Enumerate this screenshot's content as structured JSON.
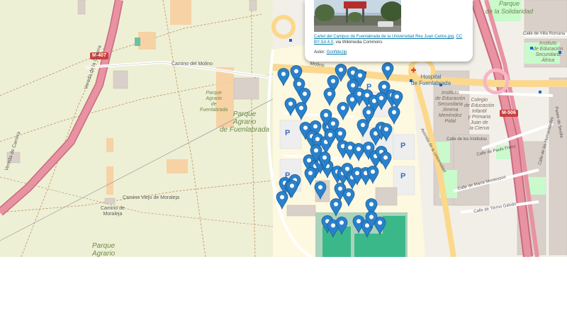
{
  "popup": {
    "caption_link": "Cartel del Campus de Fuenlabrada de la Universidad Rey Juan Carlos.jpg",
    "license_link": "CC BY-SA 4.0",
    "via_text": ", via Wikimedia Commons",
    "author_label": "Autor:",
    "author_link": "Gonfidezip"
  },
  "labels": {
    "parque_agrario_fuenlabrada_line1": "Parque",
    "parque_agrario_fuenlabrada_line2": "Agrario",
    "parque_agrario_fuenlabrada_line3": "de Fuenlabrada",
    "parque_agrario_small_line1": "Parque",
    "parque_agrario_small_line2": "Agrario",
    "parque_agrario_small_line3": "de",
    "parque_agrario_small_line4": "Fuenlabrada",
    "parque_agrario_bottom_line1": "Parque",
    "parque_agrario_bottom_line2": "Agrario",
    "parque_solidaridad_line1": "Parque",
    "parque_solidaridad_line2": "de la Solidaridad",
    "camino_molino": "Camino del Molino",
    "camino_viejo_moraleja": "Camino Viejo de Moraleja",
    "camino_moraleja_line1": "Camino de",
    "camino_moraleja_line2": "Moraleja",
    "vereda_carrera": "Vereda de la Carrera",
    "vereda_carrera_2": "Vereda de Carrera",
    "molino_short": "Molino",
    "hospital_line1": "Hospital",
    "hospital_line2": "de Fuenlabrada",
    "inst_jimena_line1": "Instituto",
    "inst_jimena_line2": "de Educación",
    "inst_jimena_line3": "Secundaria",
    "inst_jimena_line4": "Jimena",
    "inst_jimena_line5": "Menéndez",
    "inst_jimena_line6": "Pidal",
    "colegio_line1": "Colegio",
    "colegio_line2": "de Educación",
    "colegio_line3": "Infantil",
    "colegio_line4": "y Primaria",
    "colegio_line5": "Juan de",
    "colegio_line6": "la Cierva",
    "inst_africa_line1": "Instituto",
    "inst_africa_line2": "de Educación",
    "inst_africa_line3": "Secundaria",
    "inst_africa_line4": "África",
    "calle_villa_romana": "Calle de Villa Romana",
    "calle_institutos": "Calle de los Institutos",
    "calle_paulo_freire": "Calle de Paulo Freire",
    "calle_maria_montessori": "Calle de María Montessori",
    "calle_humanidades": "Calle de las Humanidades",
    "calle_tierno_galvan": "Calle de Tierno Galván",
    "avenida_universidad": "Avenida de la Universidad",
    "paseo_sevilla": "Paseo de Sevilla",
    "road_m407": "M-407",
    "road_m506": "M-506",
    "parking": "P"
  },
  "colors": {
    "farmland": "#eef0d5",
    "marker": "#2a81cb",
    "highway": "#e892a2",
    "link": "#0078a8"
  },
  "icons": [
    "map-marker-icon",
    "parking-icon"
  ]
}
